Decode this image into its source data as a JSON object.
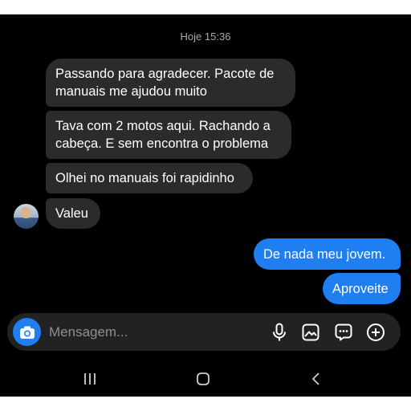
{
  "conversation": {
    "timestamp": "Hoje 15:36",
    "incoming": [
      {
        "lines": [
          "Passando para agradecer. Pacote de",
          "manuais me ajudou muito"
        ]
      },
      {
        "lines": [
          "Tava com 2 motos aqui. Rachando a",
          "cabeça. E sem encontra o problema"
        ]
      },
      {
        "lines": [
          "Olhei no manuais foi rapidinho"
        ]
      },
      {
        "lines": [
          "Valeu"
        ]
      }
    ],
    "outgoing": [
      {
        "lines": [
          "De nada  meu jovem."
        ]
      },
      {
        "lines": [
          "Aproveite"
        ]
      }
    ]
  },
  "composer": {
    "placeholder": "Mensagem...",
    "icons": [
      "camera-icon",
      "microphone-icon",
      "gallery-icon",
      "sticker-icon",
      "add-icon"
    ]
  },
  "navigation": {
    "icons": [
      "recent-apps-icon",
      "home-icon",
      "back-icon"
    ]
  },
  "colors": {
    "background": "#000000",
    "incoming_bubble": "#2b2b2b",
    "outgoing_bubble": "#1f7ff0",
    "timestamp": "#a9a9a9",
    "composer_bg": "#222222"
  }
}
